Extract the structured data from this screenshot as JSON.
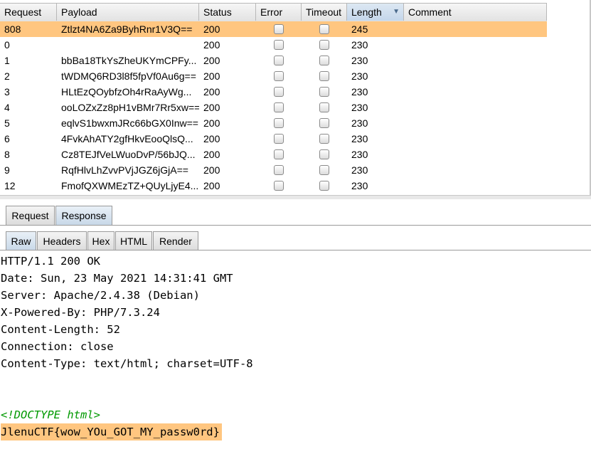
{
  "results": {
    "columns": [
      "Request",
      "Payload",
      "Status",
      "Error",
      "Timeout",
      "Length",
      "Comment"
    ],
    "sorted_column": "Length",
    "rows": [
      {
        "request": "808",
        "payload": "Ztlzt4NA6Za9ByhRnr1V3Q==",
        "status": "200",
        "error": false,
        "timeout": false,
        "length": "245",
        "comment": "",
        "selected": true
      },
      {
        "request": "0",
        "payload": "",
        "status": "200",
        "error": false,
        "timeout": false,
        "length": "230",
        "comment": ""
      },
      {
        "request": "1",
        "payload": "bbBa18TkYsZheUKYmCPFy...",
        "status": "200",
        "error": false,
        "timeout": false,
        "length": "230",
        "comment": ""
      },
      {
        "request": "2",
        "payload": "tWDMQ6RD3l8f5fpVf0Au6g==",
        "status": "200",
        "error": false,
        "timeout": false,
        "length": "230",
        "comment": ""
      },
      {
        "request": "3",
        "payload": "HLtEzQOybfzOh4rRaAyWg...",
        "status": "200",
        "error": false,
        "timeout": false,
        "length": "230",
        "comment": ""
      },
      {
        "request": "4",
        "payload": "ooLOZxZz8pH1vBMr7Rr5xw==",
        "status": "200",
        "error": false,
        "timeout": false,
        "length": "230",
        "comment": ""
      },
      {
        "request": "5",
        "payload": "eqlvS1bwxmJRc66bGX0Inw==",
        "status": "200",
        "error": false,
        "timeout": false,
        "length": "230",
        "comment": ""
      },
      {
        "request": "6",
        "payload": "4FvkAhATY2gfHkvEooQlsQ...",
        "status": "200",
        "error": false,
        "timeout": false,
        "length": "230",
        "comment": ""
      },
      {
        "request": "8",
        "payload": "Cz8TEJfVeLWuoDvP/56bJQ...",
        "status": "200",
        "error": false,
        "timeout": false,
        "length": "230",
        "comment": ""
      },
      {
        "request": "9",
        "payload": "RqfHlvLhZvvPVjJGZ6jGjA==",
        "status": "200",
        "error": false,
        "timeout": false,
        "length": "230",
        "comment": ""
      },
      {
        "request": "12",
        "payload": "FmofQXWMEzTZ+QUyLjyE4...",
        "status": "200",
        "error": false,
        "timeout": false,
        "length": "230",
        "comment": ""
      }
    ]
  },
  "message_tabs": {
    "request": "Request",
    "response": "Response",
    "active": "Response"
  },
  "view_tabs": {
    "raw": "Raw",
    "headers": "Headers",
    "hex": "Hex",
    "html": "HTML",
    "render": "Render",
    "active": "Raw"
  },
  "response": {
    "headers": [
      "HTTP/1.1 200 OK",
      "Date: Sun, 23 May 2021 14:31:41 GMT",
      "Server: Apache/2.4.38 (Debian)",
      "X-Powered-By: PHP/7.3.24",
      "Content-Length: 52",
      "Connection: close",
      "Content-Type: text/html; charset=UTF-8"
    ],
    "doctype": "<!DOCTYPE html>",
    "body": "JlenuCTF{wow_YOu_GOT_MY_passw0rd}"
  },
  "colors": {
    "selected_row": "#ffc680",
    "doctype_text": "#009900",
    "highlight": "#ffc680"
  }
}
